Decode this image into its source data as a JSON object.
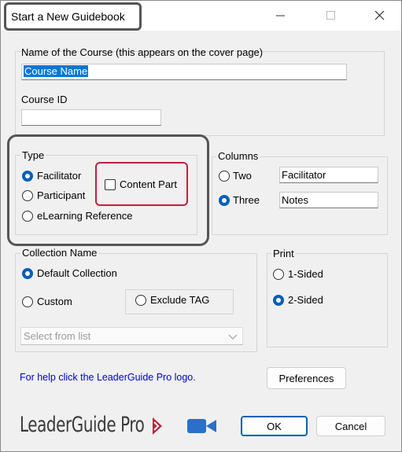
{
  "window": {
    "title": "Start a New Guidebook"
  },
  "course": {
    "name_label": "Name of the Course (this appears on the cover page)",
    "name_value": "Course Name",
    "id_label": "Course ID",
    "id_value": ""
  },
  "type": {
    "legend": "Type",
    "options": [
      "Facilitator",
      "Participant",
      "eLearning Reference"
    ],
    "selected": "Facilitator",
    "content_part_label": "Content Part"
  },
  "columns": {
    "legend": "Columns",
    "two_label": "Two",
    "three_label": "Three",
    "selected": "Three",
    "col1_value": "Facilitator",
    "col2_value": "Notes"
  },
  "collection": {
    "legend": "Collection Name",
    "default_label": "Default Collection",
    "custom_label": "Custom",
    "exclude_label": "Exclude TAG",
    "select_placeholder": "Select from list"
  },
  "print": {
    "legend": "Print",
    "one_sided": "1-Sided",
    "two_sided": "2-Sided",
    "selected": "2-Sided"
  },
  "footer": {
    "help_text": "For help click the LeaderGuide Pro logo.",
    "preferences_label": "Preferences",
    "logo_text": "LeaderGuide Pro",
    "ok_label": "OK",
    "cancel_label": "Cancel"
  },
  "colors": {
    "accent": "#005fb8",
    "highlight_red": "#c0203a",
    "help_link": "#0000cc",
    "logo_text": "#3a3a3a",
    "video_icon": "#2a6fc9"
  }
}
